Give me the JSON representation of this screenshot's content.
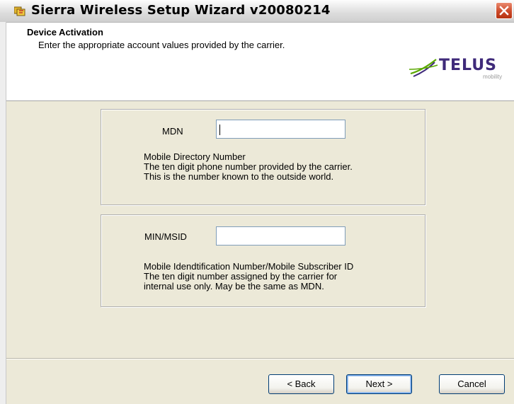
{
  "window": {
    "title": "Sierra Wireless Setup Wizard v20080214"
  },
  "header": {
    "title": "Device Activation",
    "subtitle": "Enter the appropriate account values provided by the carrier.",
    "logo_word": "TELUS",
    "logo_sub": "mobility"
  },
  "mdn_group": {
    "label": "MDN",
    "value": "",
    "desc_lines": [
      "Mobile Directory Number",
      "The ten digit phone number provided by the carrier.",
      "This is the number known to the outside world."
    ]
  },
  "min_group": {
    "label": "MIN/MSID",
    "value": "",
    "desc_lines": [
      "Mobile Idendtification Number/Mobile Subscriber ID",
      "The ten digit number assigned by the carrier for",
      "internal use only. May be the same as MDN."
    ]
  },
  "buttons": {
    "back": "< Back",
    "next": "Next >",
    "cancel": "Cancel"
  },
  "colors": {
    "logo_purple": "#3f2a7a",
    "logo_green": "#5aa800"
  },
  "icons": {
    "app": "setup-wizard-icon",
    "close": "close-icon",
    "logo": "telus-logo"
  }
}
